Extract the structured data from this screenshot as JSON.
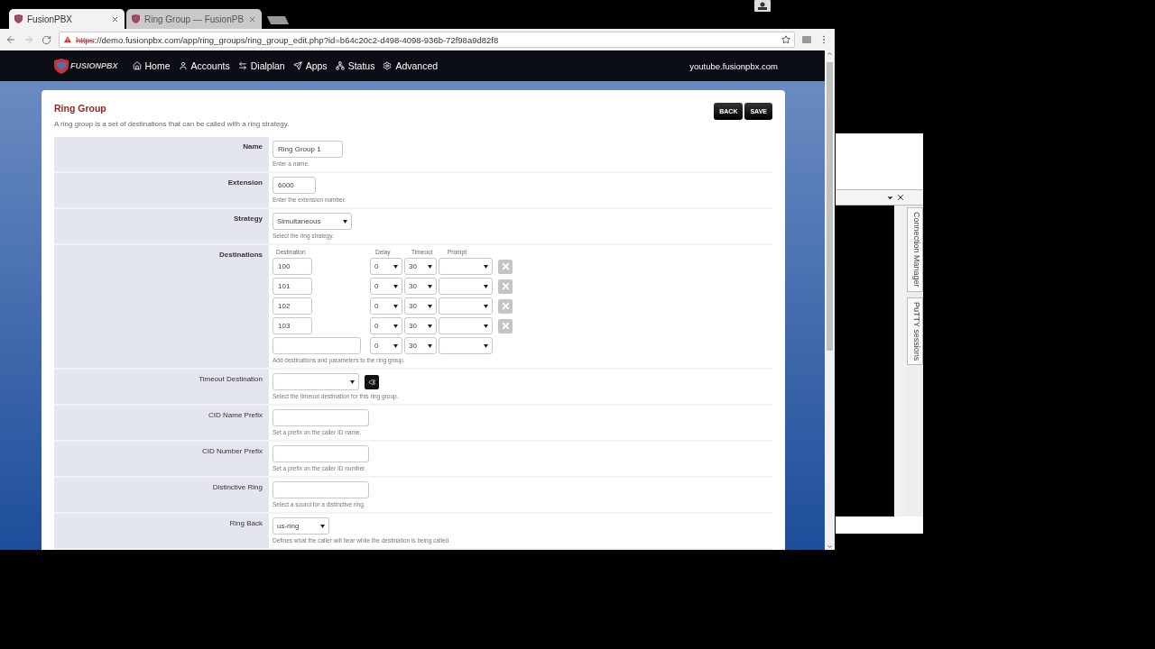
{
  "browser": {
    "tabs": [
      {
        "title": "FusionPBX",
        "selected": true
      },
      {
        "title": "Ring Group — FusionPB",
        "selected": false
      }
    ],
    "address": {
      "scheme": "https",
      "rest": "://demo.fusionpbx.com/app/ring_groups/ring_group_edit.php?id=b64c20c2-d498-4098-936b-72f98a9d82f8",
      "insecure": true
    }
  },
  "navbar": {
    "logo": "FUSIONPBX",
    "items": [
      {
        "label": "Home"
      },
      {
        "label": "Accounts"
      },
      {
        "label": "Dialplan"
      },
      {
        "label": "Apps"
      },
      {
        "label": "Status"
      },
      {
        "label": "Advanced"
      }
    ],
    "site": "youtube.fusionpbx.com"
  },
  "page": {
    "title": "Ring Group",
    "description": "A ring group is a set of destinations that can be called with a ring strategy.",
    "buttons": [
      "BACK",
      "SAVE"
    ]
  },
  "fields": [
    {
      "kind": "text",
      "label": "Name",
      "required": true,
      "value": "Ring Group 1",
      "description": "Enter a name."
    },
    {
      "kind": "text",
      "label": "Extension",
      "required": true,
      "value": "6000",
      "description": "Enter the extension number."
    },
    {
      "kind": "select",
      "label": "Strategy",
      "required": true,
      "value": "Simultaneous",
      "description": "Select the ring strategy."
    },
    {
      "kind": "destinations",
      "label": "Destinations",
      "required": true,
      "columns": [
        "Destination",
        "Delay",
        "Timeout",
        "Prompt"
      ],
      "rows": [
        {
          "destination": "100",
          "delay": "0",
          "timeout": "30",
          "removable": true
        },
        {
          "destination": "101",
          "delay": "0",
          "timeout": "30",
          "removable": true
        },
        {
          "destination": "102",
          "delay": "0",
          "timeout": "30",
          "removable": true
        },
        {
          "destination": "103",
          "delay": "0",
          "timeout": "30",
          "removable": true
        },
        {
          "delay": "0",
          "timeout": "30",
          "removable": false
        }
      ],
      "description": "Add destinations and parameters to the ring group."
    },
    {
      "kind": "select_button",
      "label": "Timeout Destination",
      "required": false,
      "description": "Select the timeout destination for this ring group."
    },
    {
      "kind": "text",
      "label": "CID Name Prefix",
      "required": false,
      "description": "Set a prefix on the caller ID name."
    },
    {
      "kind": "text",
      "label": "CID Number Prefix",
      "required": false,
      "description": "Set a prefix on the caller ID number."
    },
    {
      "kind": "text",
      "label": "Distinctive Ring",
      "required": false,
      "description": "Select a sound for a distinctive ring."
    },
    {
      "kind": "select",
      "label": "Ring Back",
      "required": false,
      "value": "us-ring",
      "description": "Defines what the caller will hear while the destination is being called."
    }
  ],
  "side_panel": {
    "tabs": [
      "Connection Manager",
      "PuTTY sessions"
    ]
  }
}
